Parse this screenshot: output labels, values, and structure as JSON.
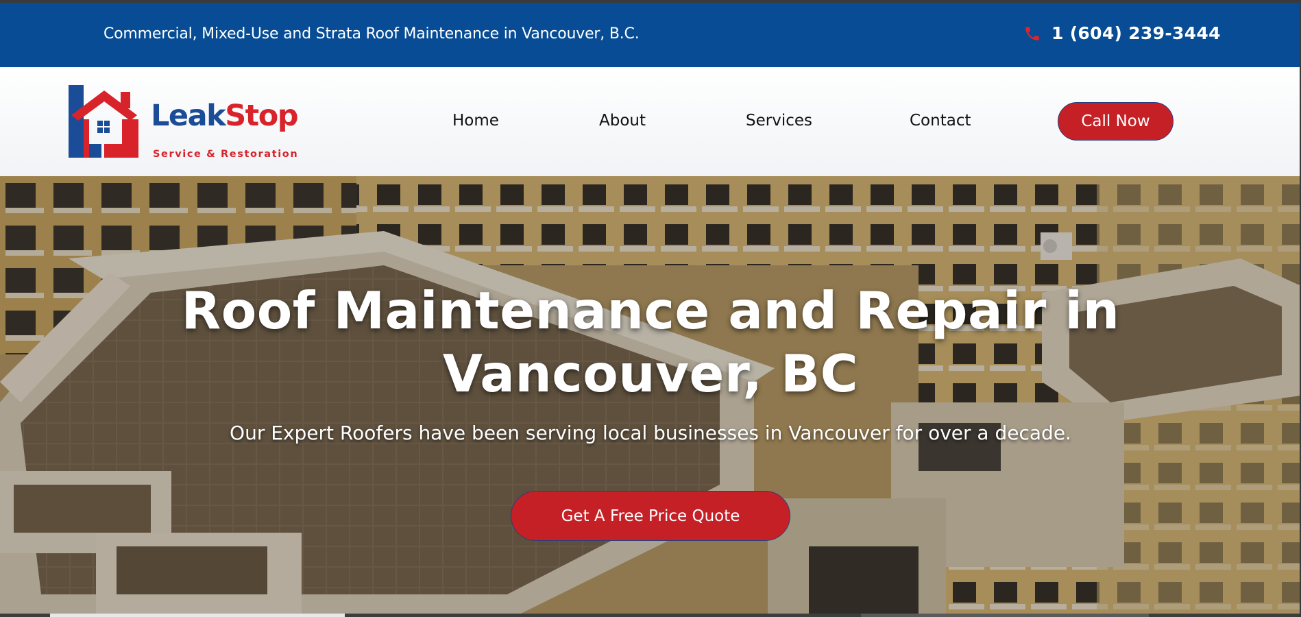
{
  "topbar": {
    "tagline": "Commercial, Mixed-Use and Strata Roof Maintenance in Vancouver, B.C.",
    "phone": "1 (604) 239-3444",
    "phone_icon": "phone-icon",
    "background": "#074c94"
  },
  "logo": {
    "brand_part1": "Leak",
    "brand_part2": "Stop",
    "subtitle": "Service & Restoration",
    "colors": {
      "blue": "#1a4c97",
      "red": "#d8232a"
    }
  },
  "nav": {
    "items": [
      {
        "label": "Home"
      },
      {
        "label": "About"
      },
      {
        "label": "Services"
      },
      {
        "label": "Contact"
      }
    ],
    "cta_label": "Call Now"
  },
  "hero": {
    "title": "Roof Maintenance and Repair in Vancouver, BC",
    "subtitle": "Our Expert Roofers have been serving local businesses in Vancouver for over a decade.",
    "cta_label": "Get A Free Price Quote",
    "accent": "#c62027"
  }
}
